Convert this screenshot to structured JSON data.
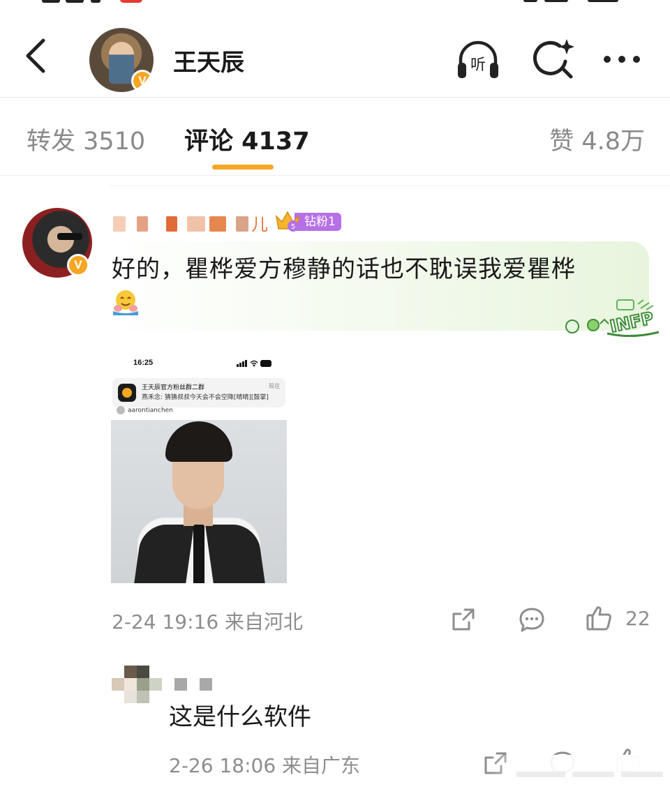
{
  "header": {
    "title": "王天辰",
    "verified_label": "V"
  },
  "tabs": [
    {
      "label": "转发 3510"
    },
    {
      "label": "评论 4137"
    },
    {
      "label": "赞 4.8万"
    }
  ],
  "accent_color": "#f5a623",
  "comment": {
    "username_suffix": "儿",
    "fan_badge": "钻粉1",
    "text": "好的，瞿桦爱方穆静的话也不耽误我爱瞿桦",
    "meta": "2-24 19:16 来自河北",
    "like_count": "22",
    "attachment": {
      "status_time": "16:25",
      "notif_title": "王天辰官方粉丝群二群",
      "notif_time": "现在",
      "notif_body": "燕禾念: 猜猜叔叔今天会不会空降[晴晴][鼓掌]",
      "handle": "aarontianchen"
    },
    "sticker_text": "INFP"
  },
  "reply": {
    "text": "这是什么软件",
    "meta": "2-26 18:06 来自广东"
  }
}
